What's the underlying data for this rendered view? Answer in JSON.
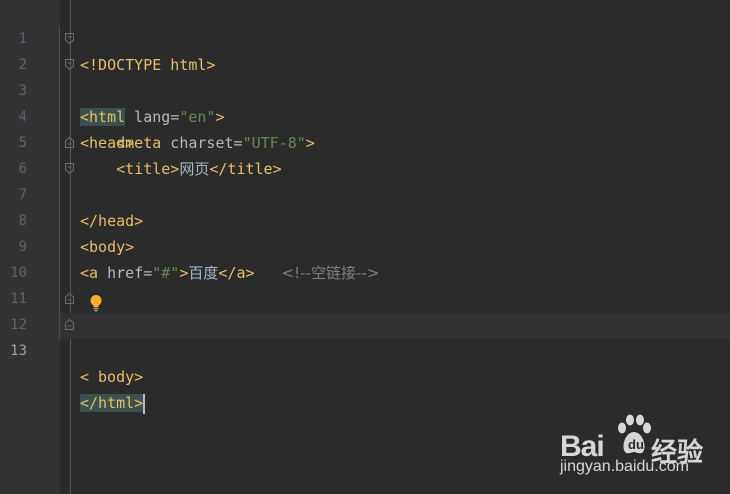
{
  "editor": {
    "language": "html",
    "current_line": 13,
    "lines": [
      {
        "n": "1"
      },
      {
        "n": "2"
      },
      {
        "n": "3"
      },
      {
        "n": "4"
      },
      {
        "n": "5"
      },
      {
        "n": "6"
      },
      {
        "n": "7"
      },
      {
        "n": "8"
      },
      {
        "n": "9"
      },
      {
        "n": "10"
      },
      {
        "n": "11"
      },
      {
        "n": "12"
      },
      {
        "n": "13"
      }
    ],
    "tokens": {
      "l1": "<!DOCTYPE html>",
      "l2_open": "<html",
      "l2_attr": " lang=",
      "l2_val": "\"en\"",
      "l2_close": ">",
      "l3": "<head>",
      "l4_indent": "    ",
      "l4_open": "<meta",
      "l4_attr": " charset=",
      "l4_val": "\"UTF-8\"",
      "l4_close": ">",
      "l5_indent": "    ",
      "l5_open": "<title>",
      "l5_text": "网页",
      "l5_close": "</title>",
      "l6": "</head>",
      "l7": "<body>",
      "l9_open": "<a",
      "l9_attr": " href=",
      "l9_val": "\"#\"",
      "l9_gt": ">",
      "l9_text": "百度",
      "l9_close": "</a>",
      "l9_gap": "   ",
      "l9_comment": "<!--空链接-->",
      "l12_a": "<",
      "l12_b": "body>",
      "l13": "</html>"
    }
  },
  "watermark": {
    "logo": "Bai",
    "logo_suffix": "经验",
    "url": "jingyan.baidu.com"
  },
  "colors": {
    "background": "#2b2b2b",
    "gutter": "#313335",
    "tag": "#e8bf6a",
    "attribute": "#bababa",
    "string": "#6a8759",
    "comment": "#808080",
    "line_number": "#606366",
    "bracket_match": "#3b514d"
  }
}
